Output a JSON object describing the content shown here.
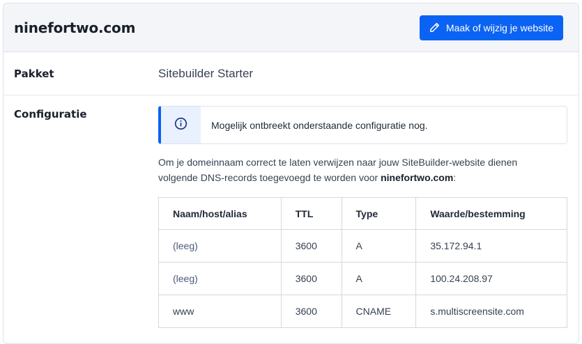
{
  "header": {
    "domain": "ninefortwo.com",
    "edit_button_label": "Maak of wijzig je website"
  },
  "package": {
    "label": "Pakket",
    "value": "Sitebuilder Starter"
  },
  "configuration": {
    "label": "Configuratie",
    "notice": "Mogelijk ontbreekt onderstaande configuratie nog.",
    "intro_text": "Om je domeinnaam correct te laten verwijzen naar jouw SiteBuilder-website dienen volgende DNS-records toegevoegd te worden voor",
    "intro_domain": "ninefortwo.com",
    "intro_suffix": ":"
  },
  "dns_table": {
    "headers": [
      "Naam/host/alias",
      "TTL",
      "Type",
      "Waarde/bestemming"
    ],
    "rows": [
      [
        "(leeg)",
        "3600",
        "A",
        "35.172.94.1"
      ],
      [
        "(leeg)",
        "3600",
        "A",
        "100.24.208.97"
      ],
      [
        "www",
        "3600",
        "CNAME",
        "s.multiscreensite.com"
      ]
    ]
  },
  "icons": {
    "edit": "pencil-icon",
    "notice": "info-icon"
  },
  "colors": {
    "primary": "#0b63f3",
    "header_bg": "#f3f5f8",
    "notice_icon_bg": "#eaf1fe"
  }
}
